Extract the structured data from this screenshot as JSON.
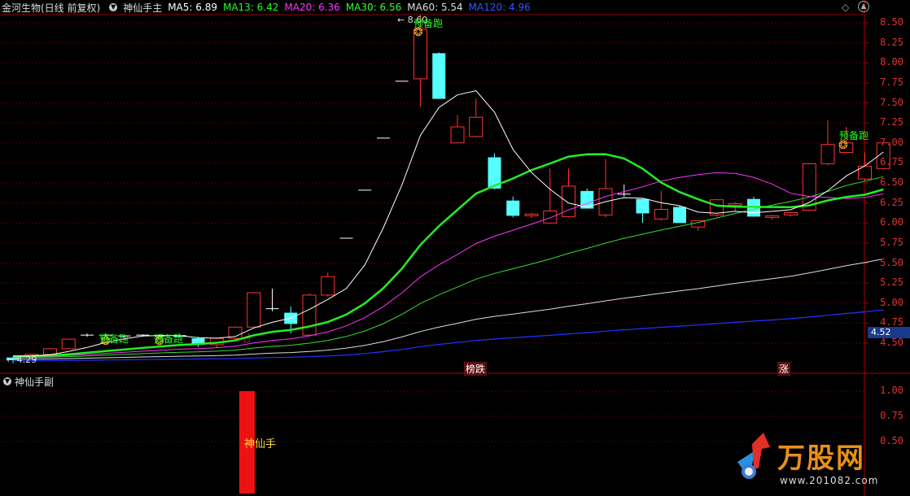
{
  "header": {
    "stock_name": "金河生物(日线 前复权)",
    "indicator": "神仙手主",
    "ma_items": [
      {
        "label": "MA5: 6.89",
        "color": "#ffffff"
      },
      {
        "label": "MA13: 6.42",
        "color": "#22ff22"
      },
      {
        "label": "MA20: 6.36",
        "color": "#ff33ff"
      },
      {
        "label": "MA30: 6.56",
        "color": "#33ff33"
      },
      {
        "label": "MA60: 5.54",
        "color": "#dddddd"
      },
      {
        "label": "MA120: 4.96",
        "color": "#3355ff"
      }
    ]
  },
  "sub_header": {
    "indicator": "神仙手副"
  },
  "price_axis": [
    "8.50",
    "8.25",
    "8.00",
    "7.75",
    "7.50",
    "7.25",
    "7.00",
    "6.75",
    "6.50",
    "6.25",
    "6.00",
    "5.75",
    "5.50",
    "5.25",
    "5.00",
    "4.75",
    "4.50"
  ],
  "sub_axis": [
    "1.00",
    "0.75",
    "0.50"
  ],
  "current_price": "4.52",
  "low_label": "4.29",
  "high_label": "8.60",
  "signal_label": "预备跑",
  "tags": {
    "fall": "榜跌",
    "rise": "涨"
  },
  "sub_bar_label": "神仙手",
  "watermark": {
    "brand": "万股网",
    "url": "www.201082.com"
  },
  "colors": {
    "up": "#ff3333",
    "down": "#55ffff",
    "grid": "#8b0000",
    "background": "#000000"
  },
  "chart_data": {
    "type": "candlestick",
    "title": "金河生物(日线 前复权)",
    "ylim": [
      4.2,
      8.65
    ],
    "candles": [
      [
        4.32,
        4.33,
        4.25,
        4.29
      ],
      [
        4.33,
        4.37,
        4.31,
        4.36
      ],
      [
        4.36,
        4.44,
        4.34,
        4.43
      ],
      [
        4.43,
        4.55,
        4.42,
        4.55
      ],
      [
        4.6,
        4.62,
        4.58,
        4.6
      ],
      [
        4.6,
        4.62,
        4.58,
        4.6
      ],
      [
        4.58,
        4.6,
        4.57,
        4.59
      ],
      [
        4.59,
        4.61,
        4.58,
        4.6
      ],
      [
        4.58,
        4.6,
        4.56,
        4.59
      ],
      [
        4.6,
        4.62,
        4.57,
        4.58
      ],
      [
        4.56,
        4.58,
        4.45,
        4.48
      ],
      [
        4.48,
        4.57,
        4.44,
        4.56
      ],
      [
        4.56,
        4.71,
        4.54,
        4.7
      ],
      [
        4.7,
        5.14,
        4.68,
        5.13
      ],
      [
        4.92,
        5.18,
        4.9,
        4.93
      ],
      [
        4.88,
        4.96,
        4.62,
        4.74
      ],
      [
        4.6,
        5.12,
        4.58,
        5.1
      ],
      [
        5.1,
        5.38,
        5.08,
        5.33
      ],
      [
        5.81,
        5.81,
        5.81,
        5.81
      ],
      [
        6.41,
        6.41,
        6.41,
        6.41
      ],
      [
        7.06,
        7.06,
        7.06,
        7.06
      ],
      [
        7.77,
        7.77,
        7.77,
        7.77
      ],
      [
        7.8,
        8.6,
        7.45,
        8.42
      ],
      [
        8.12,
        8.13,
        7.55,
        7.55
      ],
      [
        7.0,
        7.35,
        7.0,
        7.2
      ],
      [
        7.08,
        7.55,
        7.07,
        7.32
      ],
      [
        6.82,
        6.87,
        6.42,
        6.43
      ],
      [
        6.28,
        6.33,
        6.07,
        6.09
      ],
      [
        6.09,
        6.13,
        6.06,
        6.11
      ],
      [
        6.0,
        6.68,
        5.99,
        6.15
      ],
      [
        6.08,
        6.68,
        6.07,
        6.46
      ],
      [
        6.4,
        6.43,
        6.18,
        6.18
      ],
      [
        6.1,
        6.8,
        6.07,
        6.43
      ],
      [
        6.35,
        6.48,
        6.33,
        6.36
      ],
      [
        6.3,
        6.31,
        6.0,
        6.12
      ],
      [
        6.05,
        6.4,
        6.03,
        6.17
      ],
      [
        6.2,
        6.22,
        6.0,
        6.0
      ],
      [
        5.95,
        6.02,
        5.9,
        6.03
      ],
      [
        6.1,
        6.3,
        6.08,
        6.29
      ],
      [
        6.22,
        6.26,
        6.15,
        6.24
      ],
      [
        6.3,
        6.33,
        6.08,
        6.08
      ],
      [
        6.07,
        6.1,
        6.04,
        6.09
      ],
      [
        6.1,
        6.12,
        6.08,
        6.13
      ],
      [
        6.16,
        6.75,
        6.15,
        6.74
      ],
      [
        6.74,
        7.28,
        6.72,
        6.98
      ],
      [
        6.88,
        7.2,
        6.88,
        7.0
      ],
      [
        6.55,
        6.88,
        6.53,
        6.71
      ],
      [
        6.68,
        7.0,
        6.67,
        7.0
      ]
    ]
  }
}
